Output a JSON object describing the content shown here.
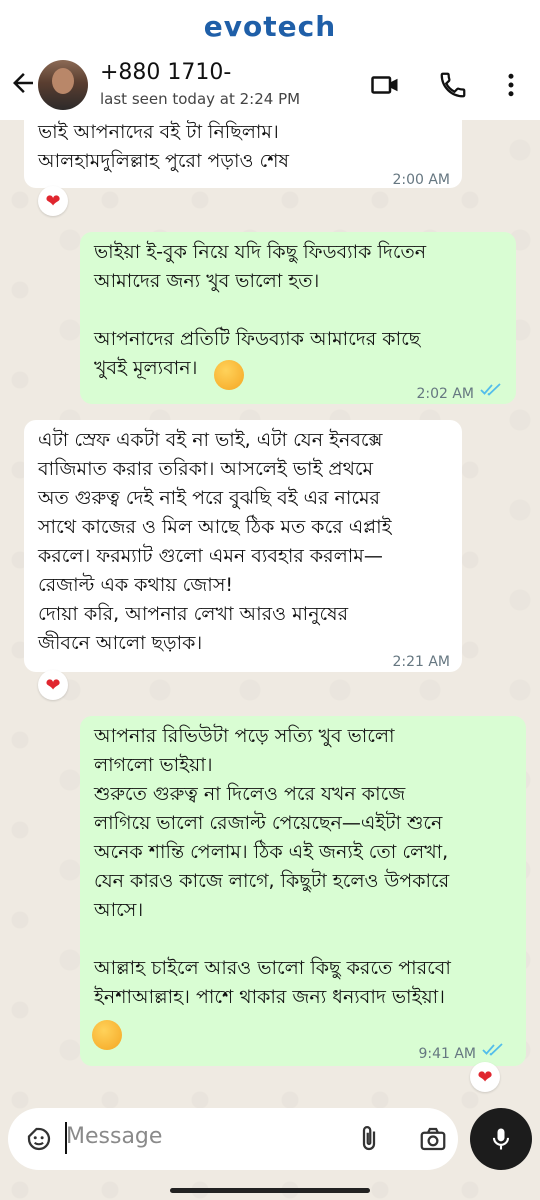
{
  "brand": "evotech",
  "header": {
    "phone": "+880 1710-",
    "last_seen": "last seen today at 2:24 PM"
  },
  "messages": [
    {
      "direction": "in",
      "lines": "ভাই আপনাদের বই টা নিছিলাম।\nআলহামদুলিল্লাহ পুরো পড়াও শেষ",
      "time": "2:00 AM",
      "reaction": "❤"
    },
    {
      "direction": "out",
      "lines": "ভাইয়া ই-বুক নিয়ে যদি কিছু ফিডব্যাক দিতেন\nআমাদের জন্য খুব ভালো হত।\n\nআপনাদের প্রতিটি ফিডব্যাক আমাদের কাছে\nখুবই মূল্যবান।",
      "time": "2:02 AM"
    },
    {
      "direction": "in",
      "lines": "এটা স্রেফ একটা বই না ভাই, এটা যেন ইনবক্সে\nবাজিমাত করার তরিকা। আসলেই ভাই প্রথমে\nঅত গুরুত্ব দেই নাই পরে বুঝছি বই এর নামের\nসাথে কাজের ও মিল আছে ঠিক মত করে এপ্লাই\nকরলে। ফরম্যাট গুলো এমন ব্যবহার করলাম—\nরেজাল্ট এক কথায় জোস!\nদোয়া করি, আপনার লেখা আরও মানুষের\nজীবনে আলো ছড়াক।",
      "time": "2:21 AM",
      "reaction": "❤"
    },
    {
      "direction": "out",
      "lines": "আপনার রিভিউটা পড়ে সত্যি খুব ভালো\nলাগলো ভাইয়া।\nশুরুতে গুরুত্ব না দিলেও পরে যখন কাজে\nলাগিয়ে ভালো রেজাল্ট পেয়েছেন—এইটা শুনে\nঅনেক শান্তি পেলাম। ঠিক এই জন্যই তো লেখা,\nযেন কারও কাজে লাগে, কিছুটা হলেও উপকারে\nআসে।\n\nআল্লাহ চাইলে আরও ভালো কিছু করতে পারবো\nইনশাআল্লাহ। পাশে থাকার জন্য ধন্যবাদ ভাইয়া।",
      "time": "9:41 AM",
      "reaction": "❤"
    }
  ],
  "input": {
    "placeholder": "Message"
  },
  "icons": {
    "back": "arrow-left-icon",
    "video": "video-camera-icon",
    "call": "phone-icon",
    "menu": "more-vert-icon",
    "sticker": "sticker-icon",
    "attach": "paperclip-icon",
    "camera": "camera-icon",
    "mic": "microphone-icon",
    "read": "double-check-icon"
  },
  "colors": {
    "brand": "#1f5fa8",
    "out_bubble": "#d9fdd3",
    "in_bubble": "#ffffff",
    "read_ticks": "#53bdeb",
    "reaction_heart": "#e0262f"
  }
}
